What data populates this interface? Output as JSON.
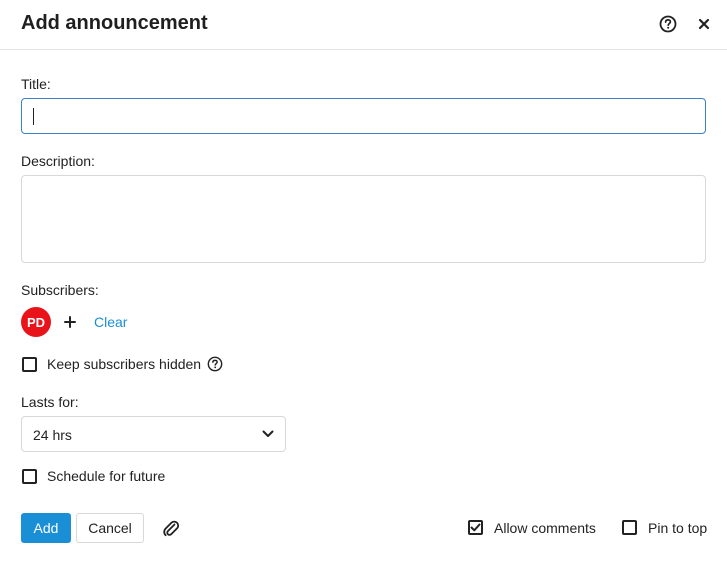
{
  "dialog": {
    "title": "Add announcement",
    "help_icon": "help-circle-icon",
    "close_icon": "close-icon"
  },
  "form": {
    "title_label": "Title:",
    "title_value": "",
    "description_label": "Description:",
    "description_value": "",
    "subscribers_label": "Subscribers:",
    "subscribers": [
      {
        "initials": "PD",
        "color": "#e8141a"
      }
    ],
    "clear_label": "Clear",
    "keep_hidden_label": "Keep subscribers hidden",
    "keep_hidden_checked": false,
    "lasts_for_label": "Lasts for:",
    "lasts_for_value": "24 hrs",
    "schedule_label": "Schedule for future",
    "schedule_checked": false
  },
  "footer": {
    "add_label": "Add",
    "cancel_label": "Cancel",
    "allow_comments_label": "Allow comments",
    "allow_comments_checked": true,
    "pin_to_top_label": "Pin to top",
    "pin_to_top_checked": false
  },
  "colors": {
    "accent": "#1a8fd6",
    "avatar": "#e8141a",
    "focus_border": "#3b82c4"
  }
}
